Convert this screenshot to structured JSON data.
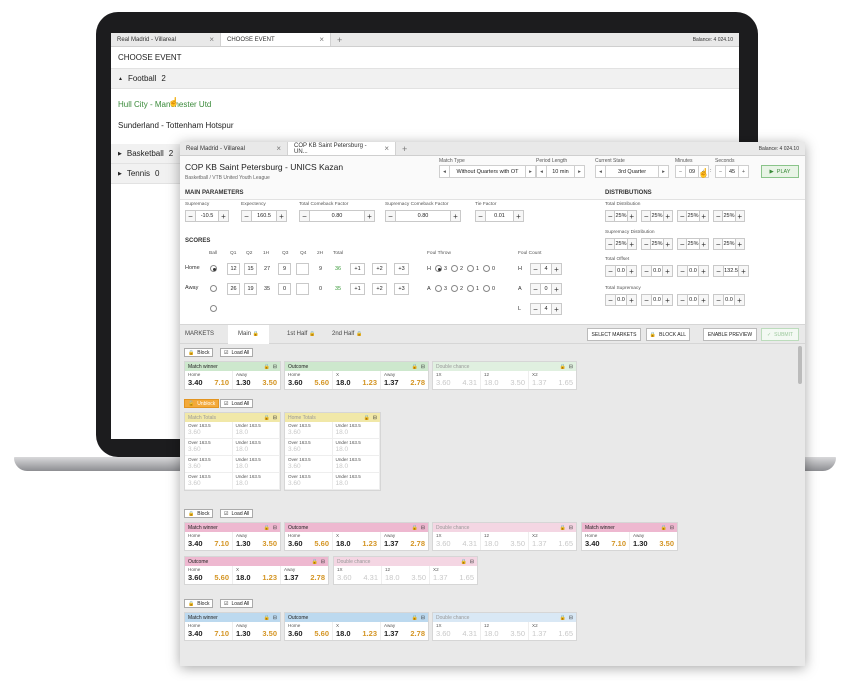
{
  "back_window": {
    "tabs": [
      {
        "label": "Real Madrid - Villareal"
      },
      {
        "label": "CHOOSE EVENT"
      }
    ],
    "balance": "Balance: 4 024.10",
    "title": "CHOOSE EVENT",
    "groups": {
      "football": "Football",
      "football_count": "2",
      "basketball": "Basketball",
      "basketball_count": "2",
      "tennis": "Tennis",
      "tennis_count": "0"
    },
    "events": [
      "Hull City - Manchester Utd",
      "Sunderland - Tottenham Hotspur"
    ]
  },
  "front_window": {
    "tabs": [
      {
        "label": "Real Madrid - Villareal"
      },
      {
        "label": "COP KB Saint Petersburg - UN..."
      }
    ],
    "balance": "Balance: 4 024.10",
    "title": "COP KB Saint Petersburg - UNICS Kazan",
    "subtitle": "Basketball / VTB United Youth League",
    "match_type": {
      "label": "Match Type",
      "value": "Without Quarters with OT"
    },
    "period_length": {
      "label": "Period Length",
      "value": "10 min"
    },
    "current_state": {
      "label": "Current State",
      "value": "3rd Quarter"
    },
    "minutes": {
      "label": "Minutes",
      "value": "09"
    },
    "seconds": {
      "label": "Seconds",
      "value": "45"
    },
    "play": "PLAY",
    "main_parameters": {
      "title": "MAIN PARAMETERS",
      "supremacy": {
        "label": "Supremacy",
        "value": "-10.5"
      },
      "expectency": {
        "label": "Expectency",
        "value": "160.5"
      },
      "total_comeback": {
        "label": "Total Comeback Factor",
        "value": "0.80"
      },
      "supremacy_comeback": {
        "label": "Supremacy Comeback Factor",
        "value": "0.80"
      },
      "tie_factor": {
        "label": "Tie Factor",
        "value": "0.01"
      }
    },
    "scores": {
      "title": "SCORES",
      "headers": [
        "Ball",
        "Q1",
        "Q2",
        "1H",
        "Q3",
        "Q4",
        "2H",
        "Total"
      ],
      "home": {
        "label": "Home",
        "q1": "12",
        "q2": "15",
        "h1": "27",
        "q3": "9",
        "h2": "9",
        "total": "36"
      },
      "away": {
        "label": "Away",
        "q1": "26",
        "q2": "19",
        "h1": "35",
        "q3": "0",
        "h2": "0",
        "total": "35"
      },
      "add_buttons": [
        "+1",
        "+2",
        "+3"
      ],
      "foul_throw": "Foul Throw",
      "foul_count": "Foul Count",
      "foul_opts": [
        "3",
        "2",
        "1",
        "0"
      ],
      "foul_h": "H",
      "foul_a": "A",
      "foul_l": "L",
      "foul_count_h": "4",
      "foul_count_a": "0",
      "foul_count_l": "4"
    },
    "distributions": {
      "title": "DISTRIBUTIONS",
      "total_distribution": {
        "label": "Total Distribution",
        "values": [
          "25%",
          "25%",
          "25%",
          "25%"
        ]
      },
      "supremacy_distribution": {
        "label": "Supremacy Distribution",
        "values": [
          "25%",
          "25%",
          "25%",
          "25%"
        ]
      },
      "total_offset": {
        "label": "Total Offset",
        "values": [
          "0.0",
          "0.0",
          "0.0",
          "132.5"
        ]
      },
      "total_supremacy": {
        "label": "Total Supremacy",
        "values": [
          "0.0",
          "0.0",
          "0.0",
          "0.0"
        ]
      }
    },
    "markets_bar": {
      "title": "MARKETS",
      "tabs": [
        "Main",
        "1st Half",
        "2nd Half"
      ],
      "select_markets": "SELECT MARKETS",
      "block_all": "BLOCK ALL",
      "enable_preview": "ENABLE PREVIEW",
      "submit": "SUBMIT"
    },
    "controls": {
      "block": "Block",
      "unblock": "Unblock",
      "load_all": "Load All"
    },
    "markets": {
      "match_winner": "Match winner",
      "outcome": "Outcome",
      "double_chance": "Double chance",
      "match_totals": "Match Totals",
      "home_totals": "Home Totals",
      "mw_labels": [
        "Home",
        "Away"
      ],
      "mw_values": [
        "3.40",
        "7.10",
        "1.30",
        "3.50"
      ],
      "oc_labels": [
        "Home",
        "X",
        "Away"
      ],
      "oc_values": [
        "3.60",
        "5.60",
        "18.0",
        "1.23",
        "1.37",
        "2.78"
      ],
      "dc_labels": [
        "1X",
        "12",
        "X2"
      ],
      "dc_values": [
        "3.60",
        "4.31",
        "18.0",
        "3.50",
        "1.37",
        "1.65"
      ],
      "over_label": "Over 163.5",
      "under_label": "Under 163.5",
      "over_value": "3.60",
      "under_value": "18.0"
    }
  }
}
